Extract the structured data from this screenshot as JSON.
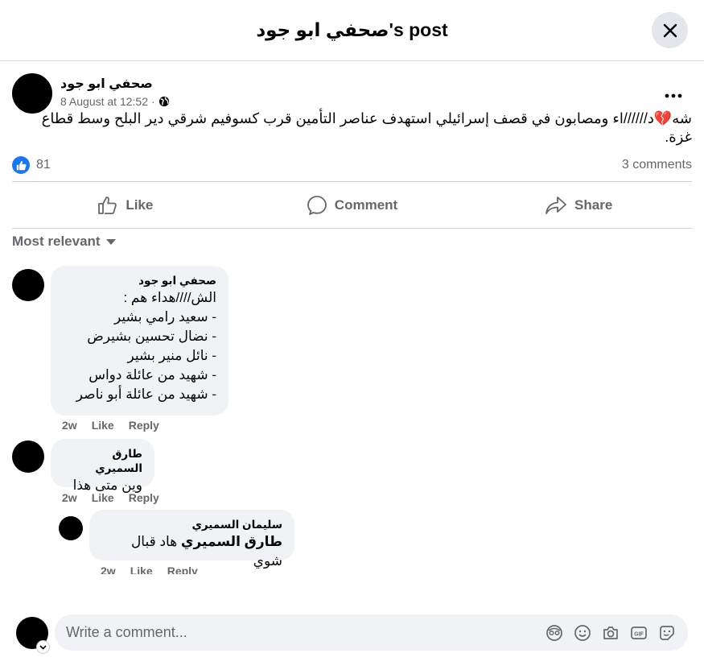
{
  "header": {
    "title": "صحفي ابو جود's post"
  },
  "post": {
    "author": "صحفي ابو جود",
    "timestamp": "8 August at 12:52",
    "separator": "·",
    "audience_icon": "globe-icon",
    "text": "شه💔د//////اء ومصابون في قصف إسرائيلي استهدف عناصر التأمين قرب كسوفيم شرقي دير البلح وسط قطاع غزة.",
    "like_count": "81",
    "comments_count": "3 comments"
  },
  "actions": {
    "like": "Like",
    "comment": "Comment",
    "share": "Share"
  },
  "sort": {
    "label": "Most relevant"
  },
  "comments": [
    {
      "author": "صحفي ابو جود",
      "text": "الش////هداء هم :\n- سعيد رامي بشير\n- نضال تحسين بشيرض\n- نائل منير بشير\n- شهيد من عائلة دواس\n- شهيد من عائلة أبو ناصر",
      "time": "2w",
      "like": "Like",
      "reply": "Reply"
    },
    {
      "author": "طارق السميري",
      "text": "وين متى هذا",
      "time": "2w",
      "like": "Like",
      "reply": "Reply"
    },
    {
      "author": "سليمان السميري",
      "mention": "طارق السميري",
      "text": " هاد قبال شوي",
      "time": "2w",
      "like": "Like",
      "reply": "Reply"
    }
  ],
  "composer": {
    "placeholder": "Write a comment...",
    "icons": [
      "avatar-sticker-icon",
      "emoji-icon",
      "camera-icon",
      "gif-icon",
      "sticker-icon"
    ]
  },
  "colors": {
    "accent": "#1877f2",
    "muted": "#65676b",
    "bubble": "#f0f2f5"
  }
}
